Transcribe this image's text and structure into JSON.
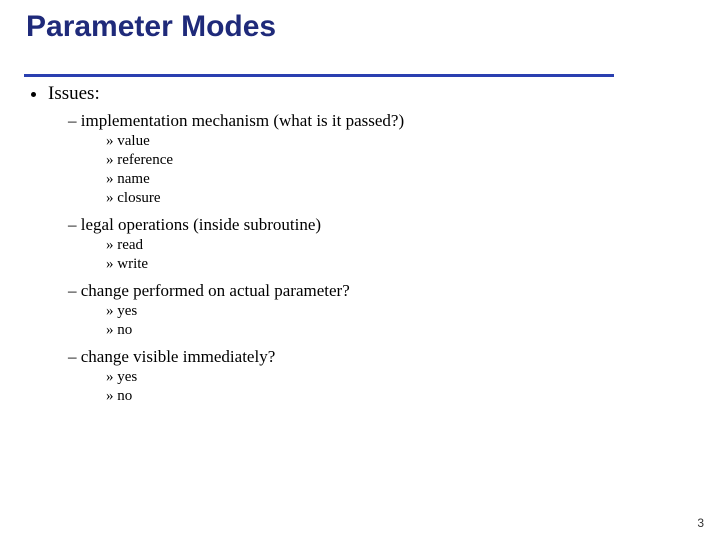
{
  "title": "Parameter Modes",
  "bullets": {
    "l1": "Issues:",
    "sections": [
      {
        "heading": "implementation mechanism (what is it passed?)",
        "items": [
          "value",
          "reference",
          "name",
          "closure"
        ]
      },
      {
        "heading": "legal operations (inside subroutine)",
        "items": [
          "read",
          "write"
        ]
      },
      {
        "heading": "change performed on actual parameter?",
        "items": [
          "yes",
          "no"
        ]
      },
      {
        "heading": "change visible immediately?",
        "items": [
          "yes",
          "no"
        ]
      }
    ]
  },
  "page_number": "3"
}
